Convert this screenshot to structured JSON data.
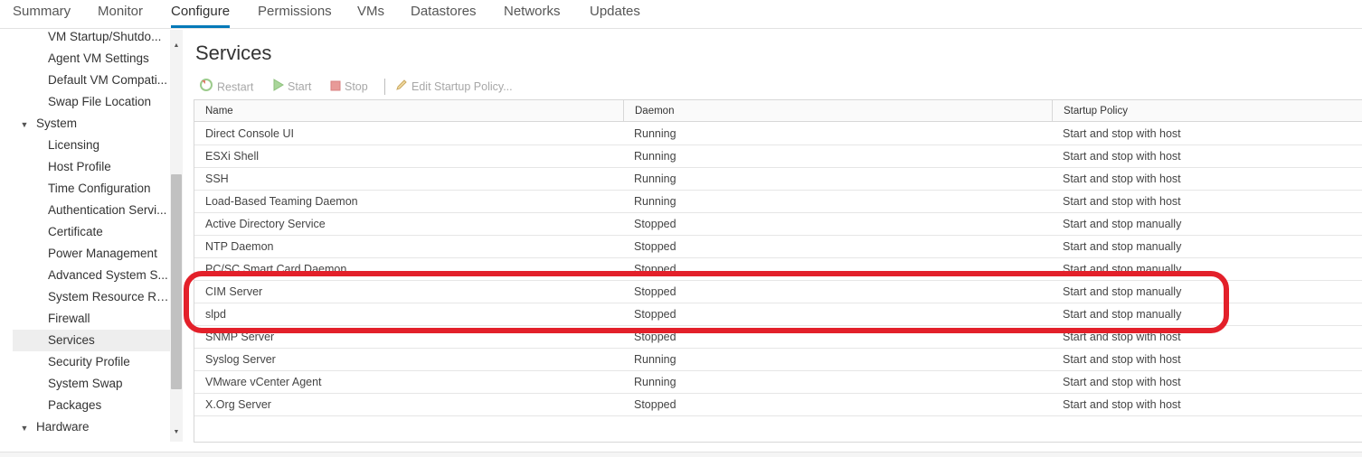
{
  "tabs": [
    "Summary",
    "Monitor",
    "Configure",
    "Permissions",
    "VMs",
    "Datastores",
    "Networks",
    "Updates"
  ],
  "active_tab": "Configure",
  "nav": {
    "items": [
      {
        "label": "VM Startup/Shutdo...",
        "type": "child"
      },
      {
        "label": "Agent VM Settings",
        "type": "child"
      },
      {
        "label": "Default VM Compati...",
        "type": "child"
      },
      {
        "label": "Swap File Location",
        "type": "child"
      },
      {
        "label": "System",
        "type": "group"
      },
      {
        "label": "Licensing",
        "type": "child"
      },
      {
        "label": "Host Profile",
        "type": "child"
      },
      {
        "label": "Time Configuration",
        "type": "child"
      },
      {
        "label": "Authentication Servi...",
        "type": "child"
      },
      {
        "label": "Certificate",
        "type": "child"
      },
      {
        "label": "Power Management",
        "type": "child"
      },
      {
        "label": "Advanced System S...",
        "type": "child"
      },
      {
        "label": "System Resource Re...",
        "type": "child"
      },
      {
        "label": "Firewall",
        "type": "child"
      },
      {
        "label": "Services",
        "type": "child",
        "selected": true
      },
      {
        "label": "Security Profile",
        "type": "child"
      },
      {
        "label": "System Swap",
        "type": "child"
      },
      {
        "label": "Packages",
        "type": "child"
      },
      {
        "label": "Hardware",
        "type": "group"
      }
    ]
  },
  "page": {
    "title": "Services"
  },
  "toolbar": {
    "restart": "Restart",
    "start": "Start",
    "stop": "Stop",
    "edit": "Edit Startup Policy..."
  },
  "grid": {
    "headers": [
      "Name",
      "Daemon",
      "Startup Policy"
    ],
    "rows": [
      [
        "Direct Console UI",
        "Running",
        "Start and stop with host"
      ],
      [
        "ESXi Shell",
        "Running",
        "Start and stop with host"
      ],
      [
        "SSH",
        "Running",
        "Start and stop with host"
      ],
      [
        "Load-Based Teaming Daemon",
        "Running",
        "Start and stop with host"
      ],
      [
        "Active Directory Service",
        "Stopped",
        "Start and stop manually"
      ],
      [
        "NTP Daemon",
        "Stopped",
        "Start and stop manually"
      ],
      [
        "PC/SC Smart Card Daemon",
        "Stopped",
        "Start and stop manually"
      ],
      [
        "CIM Server",
        "Stopped",
        "Start and stop manually"
      ],
      [
        "slpd",
        "Stopped",
        "Start and stop manually"
      ],
      [
        "SNMP Server",
        "Stopped",
        "Start and stop with host"
      ],
      [
        "Syslog Server",
        "Running",
        "Start and stop with host"
      ],
      [
        "VMware vCenter Agent",
        "Running",
        "Start and stop with host"
      ],
      [
        "X.Org Server",
        "Stopped",
        "Start and stop with host"
      ]
    ]
  },
  "colors": {
    "accent": "#0079b8",
    "highlight": "#e3202a"
  },
  "icons": {
    "restart": "restart-icon",
    "start": "play-icon",
    "stop": "stop-icon",
    "edit": "pencil-icon"
  }
}
